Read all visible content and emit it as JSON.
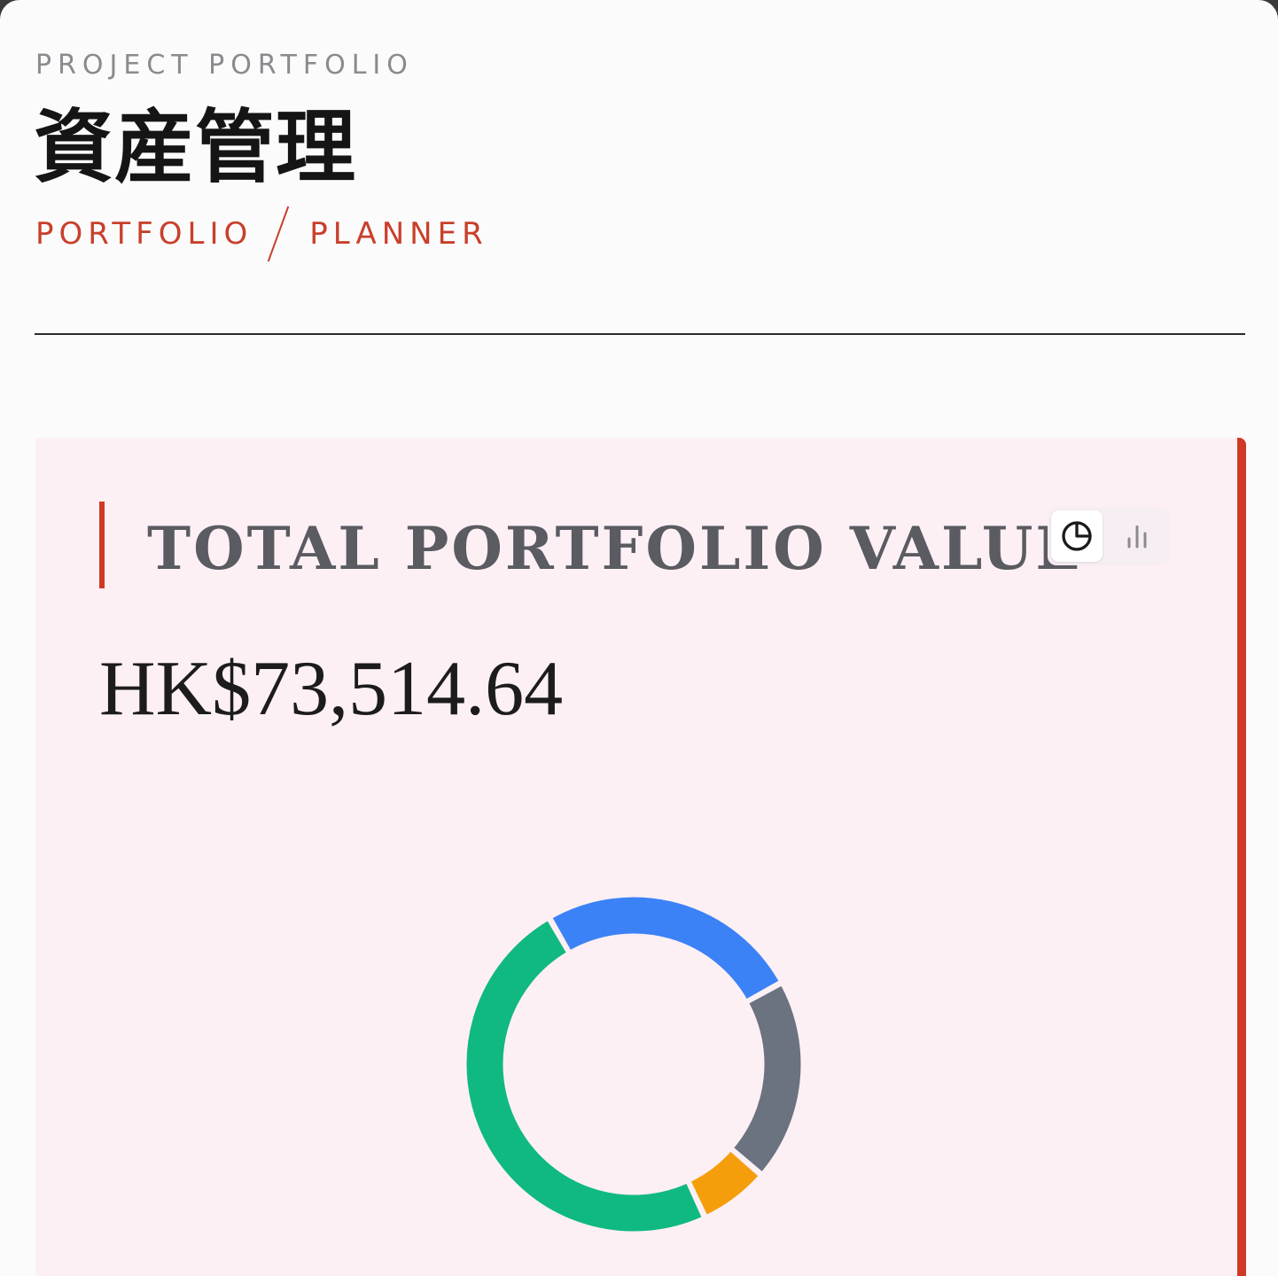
{
  "header": {
    "eyebrow": "PROJECT PORTFOLIO",
    "title": "資産管理",
    "subtitle_left": "PORTFOLIO",
    "subtitle_right": "PLANNER"
  },
  "summary": {
    "label": "TOTAL PORTFOLIO VALUE",
    "amount": "HK$73,514.64",
    "view_toggle": {
      "options": [
        {
          "icon": "pie-chart-icon",
          "selected": true
        },
        {
          "icon": "bar-chart-icon",
          "selected": false
        }
      ]
    }
  },
  "colors": {
    "accent": "#d03a24",
    "card_bg": "#fdf0f5"
  },
  "chart_data": {
    "type": "pie",
    "values": [
      25.3,
      19.4,
      6.7,
      48.6
    ],
    "colors": [
      "#3b82f6",
      "#6b7280",
      "#f59e0b",
      "#10b981"
    ],
    "start_angle_deg": -30,
    "donut": true
  }
}
